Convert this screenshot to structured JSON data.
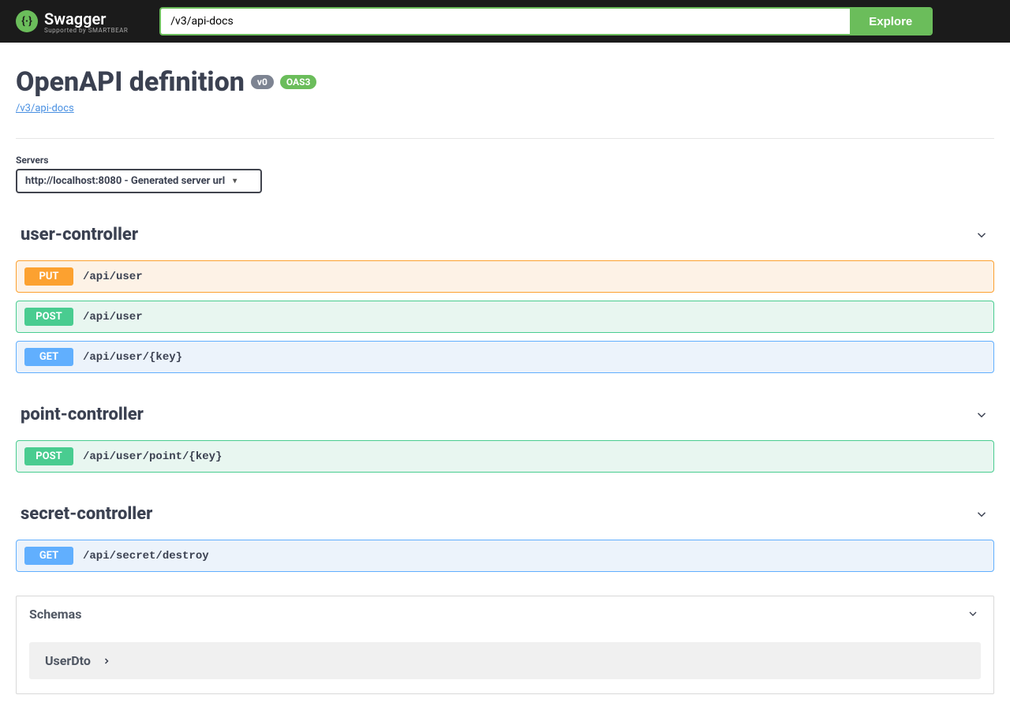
{
  "topbar": {
    "logo_text": "Swagger",
    "logo_sub": "Supported by SMARTBEAR",
    "search_value": "/v3/api-docs",
    "explore_label": "Explore"
  },
  "header": {
    "title": "OpenAPI definition",
    "version_badge": "v0",
    "oas_badge": "OAS3",
    "doc_link": "/v3/api-docs"
  },
  "servers": {
    "label": "Servers",
    "selected": "http://localhost:8080 - Generated server url"
  },
  "tags": [
    {
      "name": "user-controller",
      "ops": [
        {
          "method": "PUT",
          "path": "/api/user",
          "cls": "put"
        },
        {
          "method": "POST",
          "path": "/api/user",
          "cls": "post"
        },
        {
          "method": "GET",
          "path": "/api/user/{key}",
          "cls": "get"
        }
      ]
    },
    {
      "name": "point-controller",
      "ops": [
        {
          "method": "POST",
          "path": "/api/user/point/{key}",
          "cls": "post"
        }
      ]
    },
    {
      "name": "secret-controller",
      "ops": [
        {
          "method": "GET",
          "path": "/api/secret/destroy",
          "cls": "get"
        }
      ]
    }
  ],
  "schemas": {
    "title": "Schemas",
    "items": [
      "UserDto"
    ]
  }
}
